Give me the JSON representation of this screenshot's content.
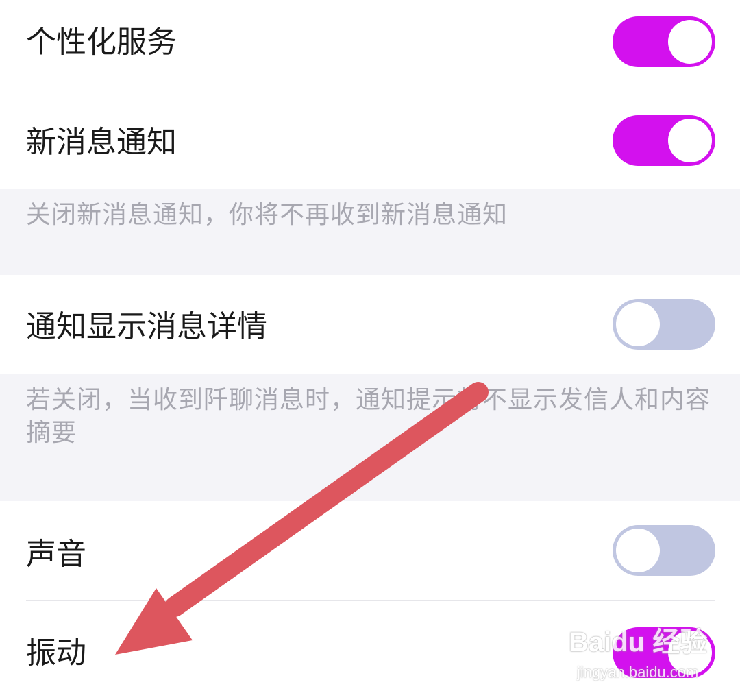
{
  "settings": {
    "personalized_service": {
      "label": "个性化服务",
      "enabled": true
    },
    "new_message_notification": {
      "label": "新消息通知",
      "enabled": true,
      "note": "关闭新消息通知，你将不再收到新消息通知"
    },
    "notification_details": {
      "label": "通知显示消息详情",
      "enabled": false,
      "note": "若关闭，当收到阡聊消息时，通知提示将不显示发信人和内容摘要"
    },
    "sound": {
      "label": "声音",
      "enabled": false
    },
    "vibration": {
      "label": "振动",
      "enabled": true
    }
  },
  "colors": {
    "toggle_on": "#d311ee",
    "toggle_off": "#c0c6e1",
    "note_background": "#f4f4f8",
    "arrow": "#dd565e"
  },
  "watermark": {
    "logo": "Baidu 经验",
    "url": "jingyan.baidu.com"
  },
  "annotation": {
    "icon": "arrow-pointer"
  }
}
